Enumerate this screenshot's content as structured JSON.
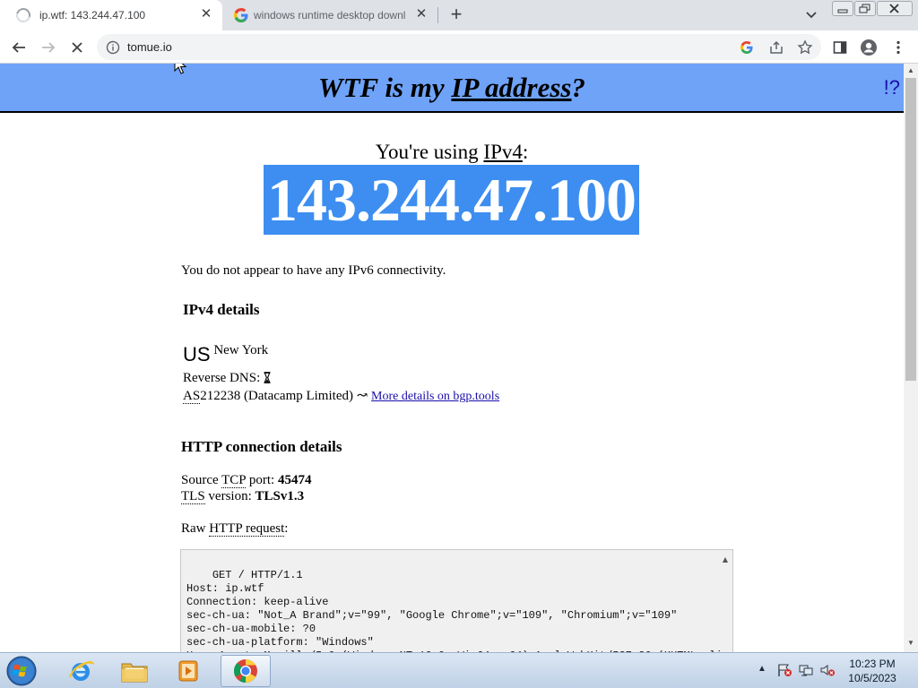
{
  "browser": {
    "tabs": [
      {
        "title": "ip.wtf: 143.244.47.100",
        "active": true,
        "loading": true
      },
      {
        "title": "windows runtime desktop downl",
        "active": false,
        "favicon": "google-icon"
      }
    ],
    "address": "tomue.io"
  },
  "page": {
    "header": {
      "pre": "WTF is my ",
      "link": "IP address",
      "post": "?",
      "help": "!?"
    },
    "using": {
      "pre": "You're using ",
      "proto": "IPv4",
      "post": ":"
    },
    "ip": "143.244.47.100",
    "ipv6_note": "You do not appear to have any IPv6 connectivity.",
    "ipv4": {
      "heading": "IPv4 details",
      "country_code": "US",
      "city": "New York",
      "reverse_dns_label": "Reverse DNS:",
      "as_abbr": "AS",
      "as_rest": "212238 (Datacamp Limited) ↝",
      "bgp_link": "More details on bgp.tools"
    },
    "http": {
      "heading": "HTTP connection details",
      "source_pre": "Source ",
      "tcp_abbr": "TCP",
      "port_label": " port: ",
      "port": "45474",
      "tls_abbr": "TLS",
      "tls_label": " version: ",
      "tls": "TLSv1.3",
      "raw_pre": "Raw ",
      "http_abbr": "HTTP request",
      "raw_post": ":",
      "raw_request": "GET / HTTP/1.1\nHost: ip.wtf\nConnection: keep-alive\nsec-ch-ua: \"Not_A Brand\";v=\"99\", \"Google Chrome\";v=\"109\", \"Chromium\";v=\"109\"\nsec-ch-ua-mobile: ?0\nsec-ch-ua-platform: \"Windows\"\nUser-Agent: Mozilla/5.0 (Windows NT 10.0; Win64; x64) AppleWebKit/537.36 (KHTML, li"
    }
  },
  "taskbar": {
    "time": "10:23 PM",
    "date": "10/5/2023"
  },
  "colors": {
    "header_bg": "#6fa3f8",
    "ip_bg": "#3d8ef0",
    "link": "#1a0dab"
  }
}
